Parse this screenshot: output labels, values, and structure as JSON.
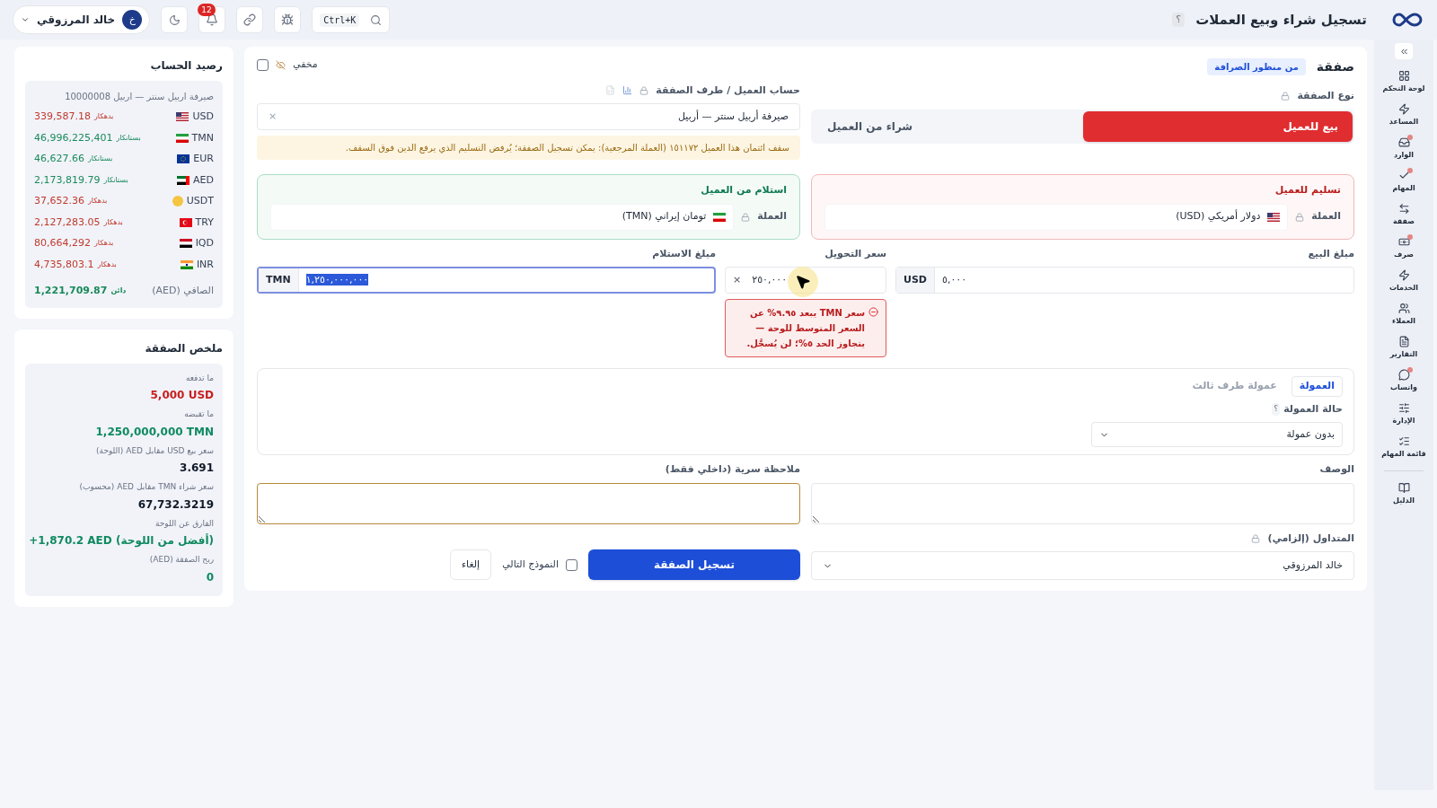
{
  "header": {
    "title": "تسجيل شراء وبيع العملات",
    "help": "؟",
    "search_shortcut": "Ctrl+K",
    "notification_count": "12",
    "user": {
      "name": "خالد المرزوقي",
      "initial": "خ"
    }
  },
  "nav": [
    {
      "label": "لوحة التحكم",
      "badge": false
    },
    {
      "label": "المساعد",
      "badge": false
    },
    {
      "label": "الوارد",
      "badge": true
    },
    {
      "label": "المهام",
      "badge": true
    },
    {
      "label": "صفقة",
      "badge": false
    },
    {
      "label": "صرف",
      "badge": true
    },
    {
      "label": "الخدمات",
      "badge": false
    },
    {
      "label": "العملاء",
      "badge": false
    },
    {
      "label": "التقارير",
      "badge": false
    },
    {
      "label": "واتساب",
      "badge": true
    },
    {
      "label": "الإدارة",
      "badge": false
    },
    {
      "label": "قائمة المهام",
      "badge": false
    },
    {
      "label": "الدليل",
      "badge": false
    }
  ],
  "deal": {
    "title": "صفقة",
    "perspective": "من منظور الصرافة",
    "hidden": {
      "label": "مخفي",
      "checked": false
    },
    "type_label": "نوع الصفقة",
    "types": [
      {
        "label": "بيع للعميل",
        "selected": true
      },
      {
        "label": "شراء من العميل",
        "selected": false
      }
    ],
    "account_label": "حساب العميل / طرف الصفقة",
    "account_value": "صيرفة أربيل سنتر — أربيل",
    "clear": "×",
    "credit_warning": "سقف ائتمان هذا العميل ١٥١١٧٢ (العملة المرجعية): يمكن تسجيل الصفقة؛ يُرفض التسليم الذي يرفع الدين فوق السقف.",
    "deliver": {
      "title": "تسليم للعميل",
      "currency_label": "العملة",
      "currency": "دولار أمريكي (USD)"
    },
    "receive": {
      "title": "استلام من العميل",
      "currency_label": "العملة",
      "currency": "تومان إيراني (TMN)"
    },
    "sell_amount": {
      "label": "مبلغ البيع",
      "currency": "USD",
      "value": "٥,٠٠٠"
    },
    "rate": {
      "label": "سعر التحويل",
      "value": "٢٥٠,٠٠٠",
      "clear": "×",
      "error": "سعر TMN يبعد ٩.٩٥% عن السعر المتوسط للوحة — يتجاوز الحد ٥%؛ لن يُسجَّل."
    },
    "receive_amount": {
      "label": "مبلغ الاستلام",
      "currency": "TMN",
      "value": "١,٢٥٠,٠٠٠,٠٠٠"
    },
    "commission_tabs": [
      {
        "label": "العمولة",
        "selected": true
      },
      {
        "label": "عمولة طرف ثالث",
        "selected": false
      }
    ],
    "commission_status_label": "حالة العمولة",
    "commission_help": "؟",
    "commission_status": "بدون عمولة",
    "description_label": "الوصف",
    "secret_note_label": "ملاحظة سرية (داخلي فقط)",
    "trader_label": "المتداول (إلزامي)",
    "trader": "خالد المرزوقي",
    "save": "تسجيل الصفقة",
    "next_form": {
      "label": "النموذج التالي",
      "checked": false
    },
    "cancel": "إلغاء"
  },
  "balance": {
    "title": "رصيد الحساب",
    "account": "صيرفة اربيل سنتر — اربيل 10000008",
    "rows": [
      {
        "code": "USD",
        "color": "#c0392b",
        "status_label": "بدهكار",
        "amount": "339,587.18"
      },
      {
        "code": "TMN",
        "color": "#1a8a5a",
        "status_label": "بستانكار",
        "amount": "46,996,225,401"
      },
      {
        "code": "EUR",
        "color": "#1a8a5a",
        "status_label": "بستانكار",
        "amount": "46,627.66"
      },
      {
        "code": "AED",
        "color": "#1a8a5a",
        "status_label": "بستانكار",
        "amount": "2,173,819.79"
      },
      {
        "code": "USDT",
        "color": "#c0392b",
        "status_label": "بدهكار",
        "amount": "37,652.36"
      },
      {
        "code": "TRY",
        "color": "#c0392b",
        "status_label": "بدهكار",
        "amount": "2,127,283.05"
      },
      {
        "code": "IQD",
        "color": "#c0392b",
        "status_label": "بدهكار",
        "amount": "80,664,292"
      },
      {
        "code": "INR",
        "color": "#c0392b",
        "status_label": "بدهكار",
        "amount": "4,735,803.1"
      }
    ],
    "net_label": "الصافي (AED)",
    "net_status_label": "دائن",
    "net_amount": "1,221,709.87"
  },
  "summary": {
    "title": "ملخص الصفقة",
    "items": [
      {
        "label": "ما تدفعه",
        "value": "5,000 USD",
        "color": "#c81e1e"
      },
      {
        "label": "ما تقبضه",
        "value": "1,250,000,000 TMN",
        "color": "#0f8a5f"
      },
      {
        "label": "سعر بيع USD مقابل AED (اللوحة)",
        "value": "3.691",
        "color": "#111827"
      },
      {
        "label": "سعر شراء TMN مقابل AED (محسوب)",
        "value": "67,732.3219",
        "color": "#111827"
      },
      {
        "label": "الفارق عن اللوحة",
        "value": "+1,870.2 AED (أفضل من اللوحة)",
        "color": "#0f8a5f"
      },
      {
        "label": "ربح الصفقة (AED)",
        "value": "0",
        "color": "#0f8a5f"
      }
    ]
  }
}
